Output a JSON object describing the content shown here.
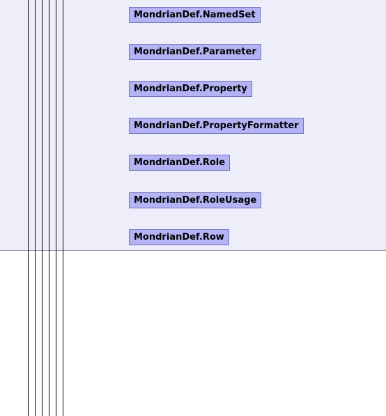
{
  "diagram": {
    "colors": {
      "package_background": "#eeeefa",
      "class_fill": "#b3b3f5",
      "class_border": "#7272b8",
      "line": "#000000"
    },
    "classes": [
      {
        "name": "MondrianDef.NamedSet"
      },
      {
        "name": "MondrianDef.Parameter"
      },
      {
        "name": "MondrianDef.Property"
      },
      {
        "name": "MondrianDef.PropertyFormatter"
      },
      {
        "name": "MondrianDef.Role"
      },
      {
        "name": "MondrianDef.RoleUsage"
      },
      {
        "name": "MondrianDef.Row"
      }
    ]
  }
}
